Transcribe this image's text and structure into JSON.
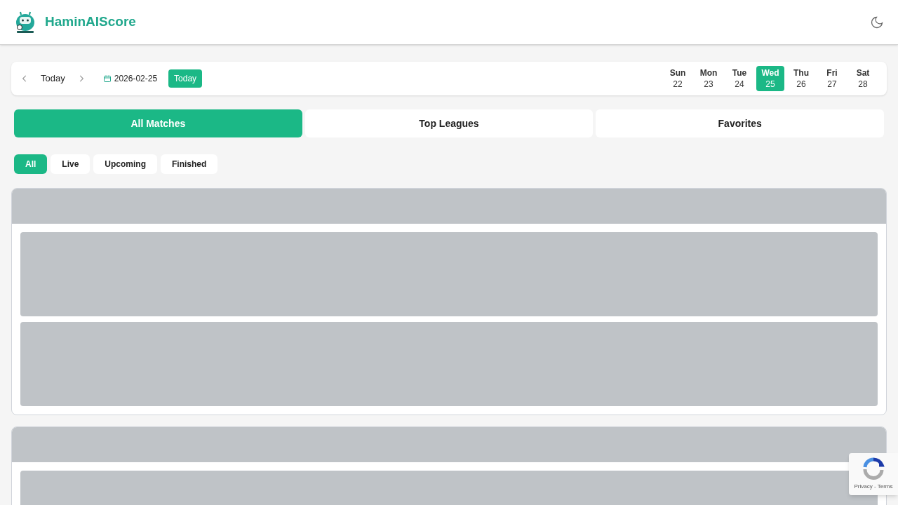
{
  "header": {
    "brand": "HaminAIScore"
  },
  "date_nav": {
    "label": "Today",
    "date": "2026-02-25",
    "today_button": "Today"
  },
  "week": [
    {
      "day": "Sun",
      "date": "22",
      "selected": false
    },
    {
      "day": "Mon",
      "date": "23",
      "selected": false
    },
    {
      "day": "Tue",
      "date": "24",
      "selected": false
    },
    {
      "day": "Wed",
      "date": "25",
      "selected": true
    },
    {
      "day": "Thu",
      "date": "26",
      "selected": false
    },
    {
      "day": "Fri",
      "date": "27",
      "selected": false
    },
    {
      "day": "Sat",
      "date": "28",
      "selected": false
    }
  ],
  "tabs": [
    {
      "label": "All Matches",
      "selected": true
    },
    {
      "label": "Top Leagues",
      "selected": false
    },
    {
      "label": "Favorites",
      "selected": false
    }
  ],
  "filters": [
    {
      "label": "All",
      "selected": true
    },
    {
      "label": "Live",
      "selected": false
    },
    {
      "label": "Upcoming",
      "selected": false
    },
    {
      "label": "Finished",
      "selected": false
    }
  ],
  "recaptcha": {
    "links": "Privacy - Terms"
  }
}
